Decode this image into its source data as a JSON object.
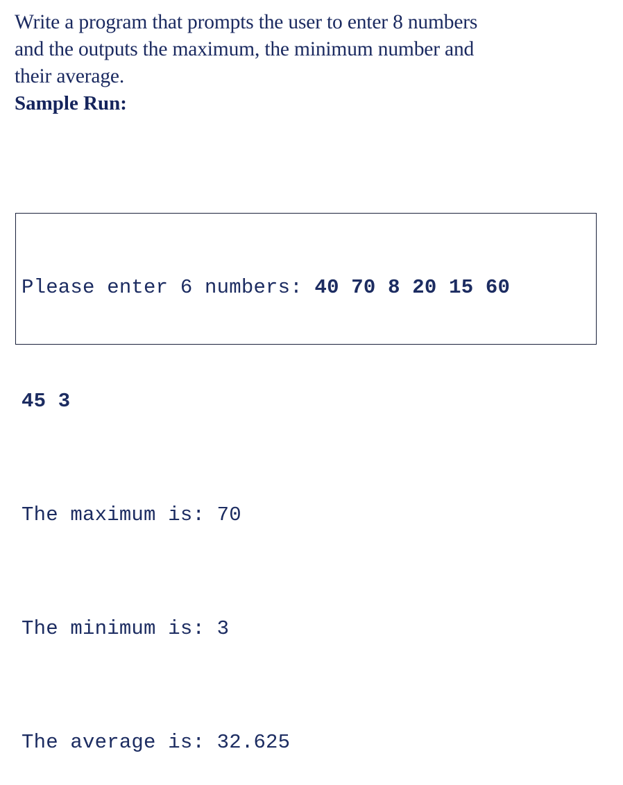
{
  "colors": {
    "text_navy": "#1b2a60",
    "console_navy": "#1c2c61",
    "border": "#19203a",
    "background": "#ffffff"
  },
  "prompt": {
    "lines": [
      "Write a program that prompts the user to enter 8 numbers",
      "and the outputs the maximum, the minimum number and",
      "their average."
    ],
    "sample_run_label": "Sample Run:"
  },
  "console": {
    "lines": [
      {
        "id": "prompt-and-input",
        "static_text": "Please enter 6 numbers: ",
        "user_input": "40 70 8 20 15 60"
      },
      {
        "id": "input-wrap",
        "static_text": "",
        "user_input": "45 3"
      },
      {
        "id": "maximum",
        "static_text": "The maximum is: 70",
        "user_input": ""
      },
      {
        "id": "minimum",
        "static_text": "The minimum is: 3",
        "user_input": ""
      },
      {
        "id": "average",
        "static_text": "The average is: 32.625",
        "user_input": ""
      }
    ],
    "numbers_entered": [
      40,
      70,
      8,
      20,
      15,
      60,
      45,
      3
    ],
    "maximum": 70,
    "minimum": 3,
    "average": 32.625,
    "requested_count": 6
  }
}
